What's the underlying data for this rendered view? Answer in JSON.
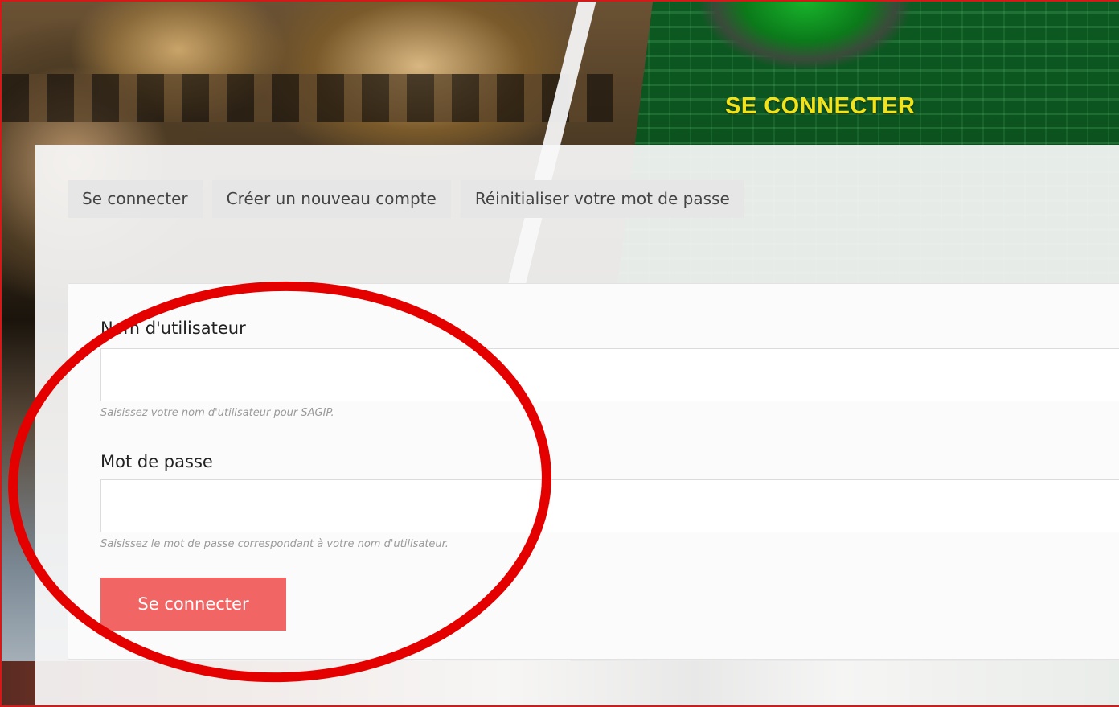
{
  "header": {
    "title": "SE CONNECTER"
  },
  "tabs": [
    {
      "label": "Se connecter"
    },
    {
      "label": "Créer un nouveau compte"
    },
    {
      "label": "Réinitialiser votre mot de passe"
    }
  ],
  "form": {
    "username": {
      "label": "Nom d'utilisateur",
      "value": "",
      "description": "Saisissez votre nom d'utilisateur pour SAGIP."
    },
    "password": {
      "label": "Mot de passe",
      "value": "",
      "description": "Saisissez le mot de passe correspondant à votre nom d'utilisateur."
    },
    "submit_label": "Se connecter"
  },
  "colors": {
    "title": "#f2e21a",
    "button": "#f26565",
    "annotation": "#e50000",
    "frame_border": "#d61818"
  }
}
